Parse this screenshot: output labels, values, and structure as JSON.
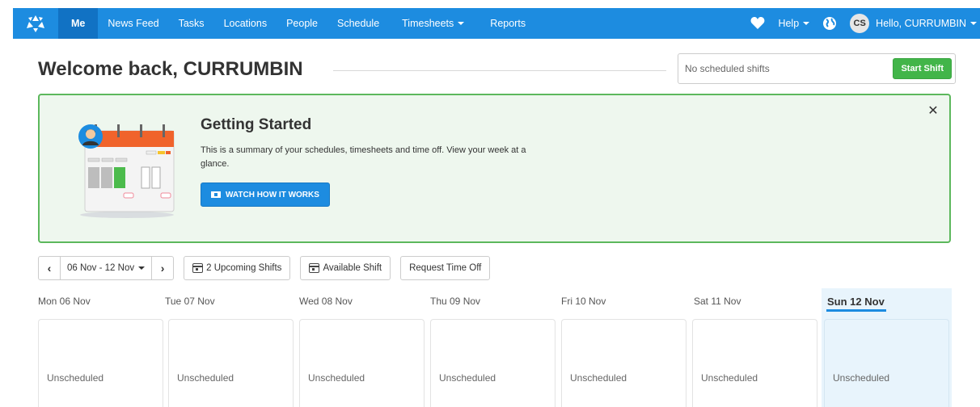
{
  "nav": {
    "items": [
      {
        "label": "Me",
        "active": true
      },
      {
        "label": "News Feed"
      },
      {
        "label": "Tasks"
      },
      {
        "label": "Locations"
      },
      {
        "label": "People"
      },
      {
        "label": "Schedule"
      },
      {
        "label": "Timesheets",
        "dropdown": true
      },
      {
        "label": "Reports"
      }
    ],
    "help_label": "Help",
    "avatar_initials": "CS",
    "user_greeting": "Hello, CURRUMBIN",
    "icons": {
      "logo": "deputy-logo-icon",
      "heart": "heart-icon",
      "globe": "globe-icon"
    },
    "colors": {
      "bar": "#1d8ce0",
      "active": "#1172c4"
    }
  },
  "header": {
    "welcome": "Welcome back, CURRUMBIN",
    "shift_status": "No scheduled shifts",
    "start_shift_label": "Start Shift"
  },
  "getting_started": {
    "title": "Getting Started",
    "description": "This is a summary of your schedules, timesheets and time off. View your week at a glance.",
    "watch_label": "WATCH HOW IT WORKS",
    "close_icon": "close-icon"
  },
  "toolbar": {
    "date_range": "06 Nov - 12 Nov",
    "upcoming_shifts": "2 Upcoming Shifts",
    "available_shift": "Available Shift",
    "request_time_off": "Request Time Off"
  },
  "week": {
    "days": [
      {
        "label": "Mon 06 Nov",
        "status": "Unscheduled"
      },
      {
        "label": "Tue 07 Nov",
        "status": "Unscheduled"
      },
      {
        "label": "Wed 08 Nov",
        "status": "Unscheduled"
      },
      {
        "label": "Thu 09 Nov",
        "status": "Unscheduled"
      },
      {
        "label": "Fri 10 Nov",
        "status": "Unscheduled"
      },
      {
        "label": "Sat 11 Nov",
        "status": "Unscheduled"
      },
      {
        "label": "Sun 12 Nov",
        "status": "Unscheduled",
        "today": true
      }
    ]
  }
}
